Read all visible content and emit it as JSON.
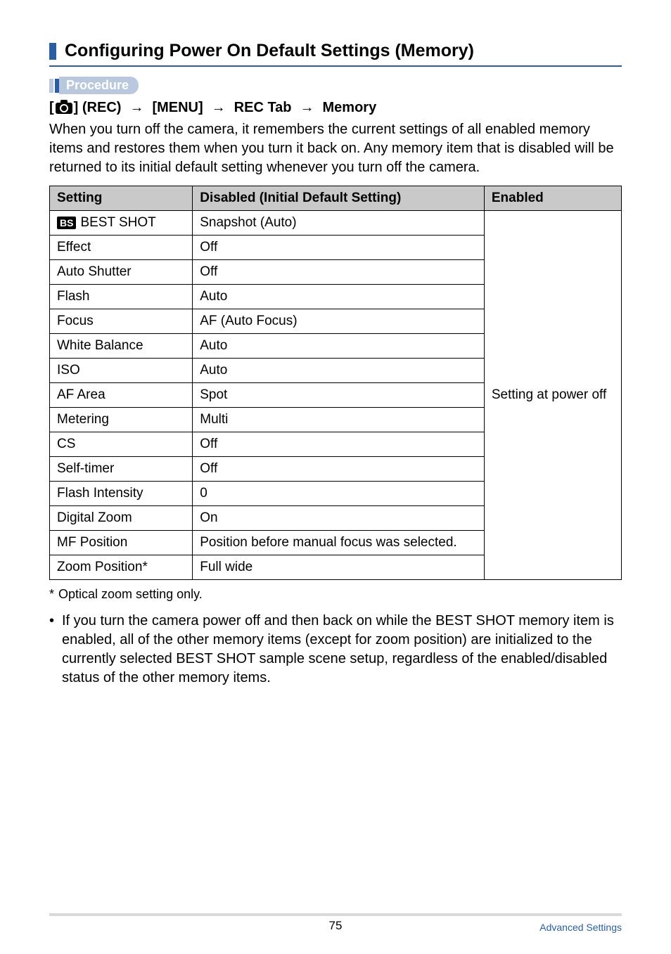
{
  "heading": "Configuring Power On Default Settings (Memory)",
  "procedure_label": "Procedure",
  "breadcrumb": {
    "open_bracket": "[",
    "rec_suffix": "] (REC)",
    "menu": "[MENU]",
    "rec_tab": "REC Tab",
    "memory": "Memory"
  },
  "intro": "When you turn off the camera, it remembers the current settings of all enabled memory items and restores them when you turn it back on. Any memory item that is disabled will be returned to its initial default setting whenever you turn off the camera.",
  "table": {
    "headers": {
      "setting": "Setting",
      "disabled": "Disabled (Initial Default Setting)",
      "enabled": "Enabled"
    },
    "bs_icon_text": "BS",
    "rows": [
      {
        "setting": "BEST SHOT",
        "disabled": "Snapshot (Auto)",
        "icon": true
      },
      {
        "setting": "Effect",
        "disabled": "Off"
      },
      {
        "setting": "Auto Shutter",
        "disabled": "Off"
      },
      {
        "setting": "Flash",
        "disabled": "Auto"
      },
      {
        "setting": "Focus",
        "disabled": "AF (Auto Focus)"
      },
      {
        "setting": "White Balance",
        "disabled": "Auto"
      },
      {
        "setting": "ISO",
        "disabled": "Auto"
      },
      {
        "setting": "AF Area",
        "disabled": "Spot"
      },
      {
        "setting": "Metering",
        "disabled": "Multi"
      },
      {
        "setting": "CS",
        "disabled": "Off"
      },
      {
        "setting": "Self-timer",
        "disabled": "Off"
      },
      {
        "setting": "Flash Intensity",
        "disabled": "0"
      },
      {
        "setting": "Digital Zoom",
        "disabled": "On"
      },
      {
        "setting": "MF Position",
        "disabled": "Position before manual focus was selected."
      },
      {
        "setting": "Zoom Position*",
        "disabled": "Full wide"
      }
    ],
    "enabled_text": "Setting at power off"
  },
  "footnote": {
    "ast": "*",
    "text": "Optical zoom setting only."
  },
  "bullet": "If you turn the camera power off and then back on while the BEST SHOT memory item is enabled, all of the other memory items (except for zoom position) are initialized to the currently selected BEST SHOT sample scene setup, regardless of the enabled/disabled status of the other memory items.",
  "footer": {
    "page": "75",
    "section": "Advanced Settings"
  }
}
